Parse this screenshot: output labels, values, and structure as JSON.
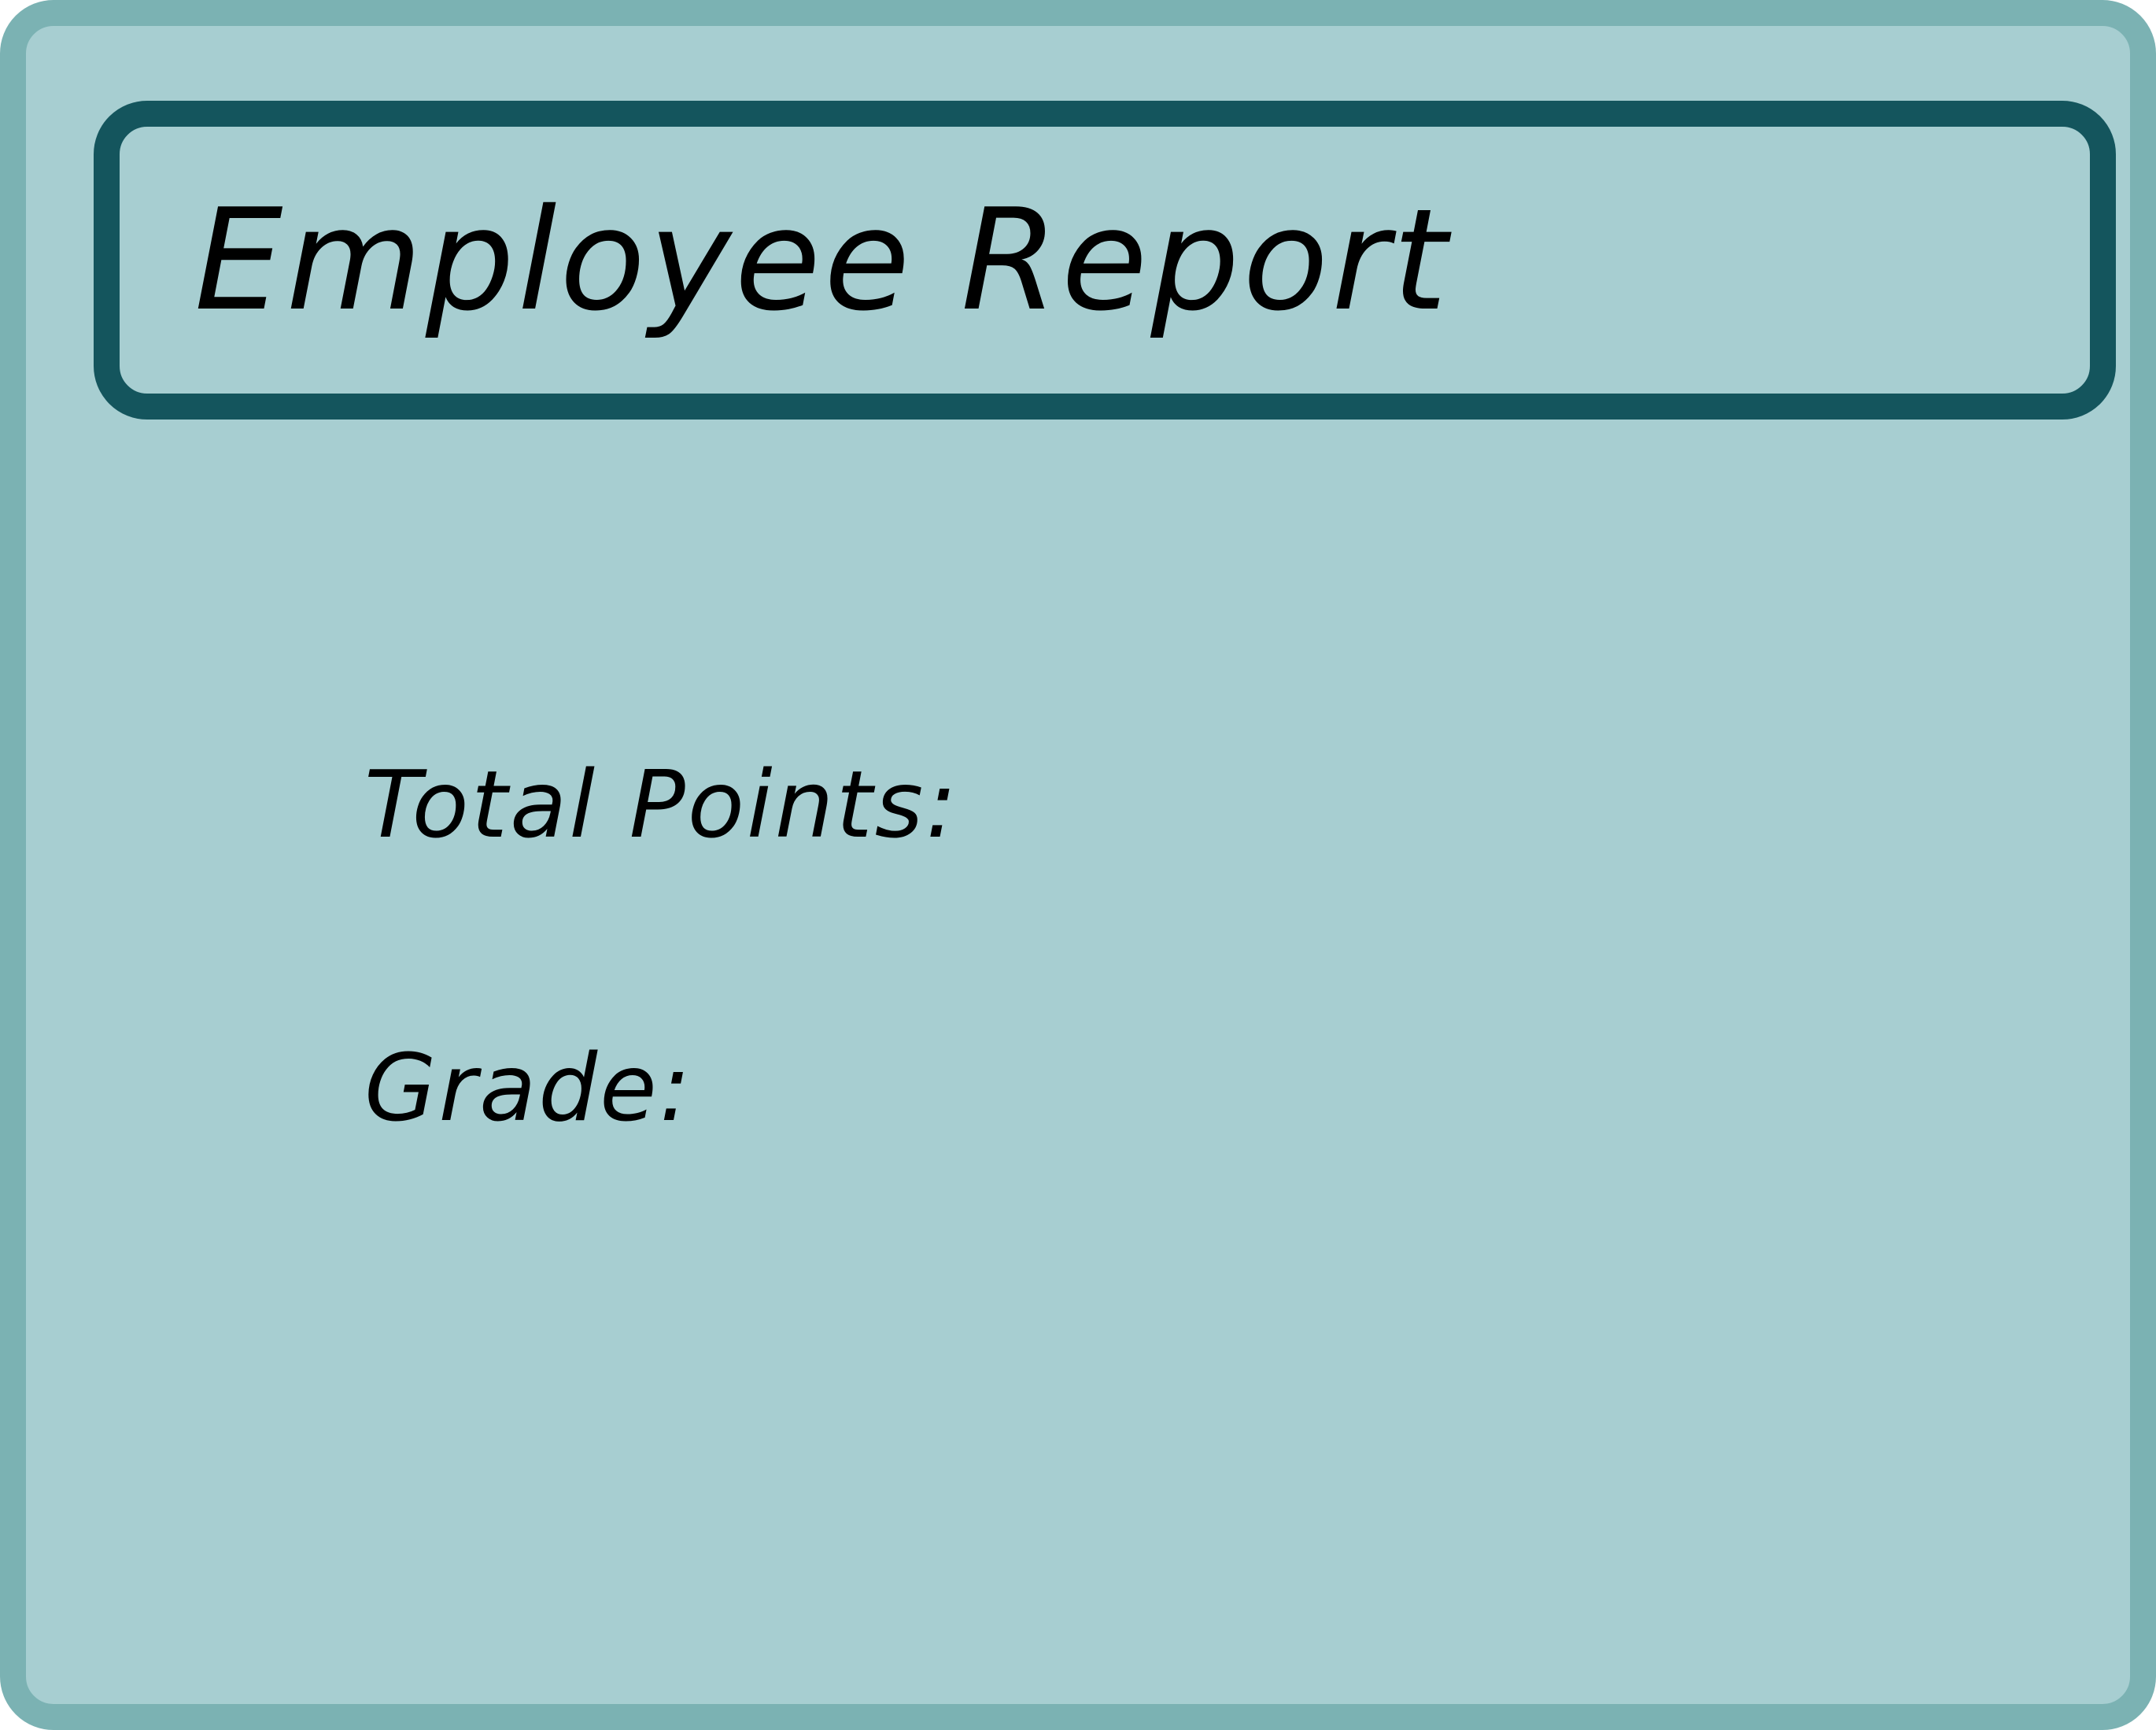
{
  "report": {
    "title": "Employee Report",
    "fields": [
      {
        "label": "Total Points:",
        "value": ""
      },
      {
        "label": "Grade:",
        "value": ""
      }
    ]
  },
  "colors": {
    "window_background": "#a7ced1",
    "window_border": "#7bb2b3",
    "title_border": "#14555d",
    "text": "#000000"
  }
}
